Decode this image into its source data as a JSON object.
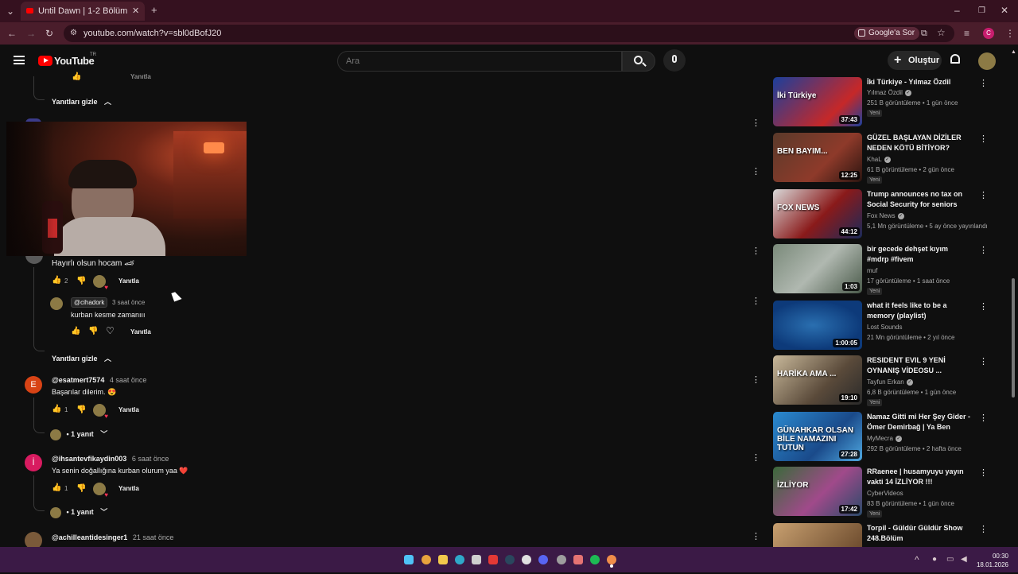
{
  "browser": {
    "tab_title": "Until Dawn | 1-2 Bölüm - YouTube",
    "url": "youtube.com/watch?v=sbl0dBofJ20",
    "google_button": "Google'a Sor"
  },
  "header": {
    "logo": "YouTube",
    "region": "TR",
    "search_placeholder": "Ara",
    "create_label": "Oluştur"
  },
  "comments": {
    "hide_replies": "Yanıtları gizle",
    "reply_label": "Yanıtla",
    "c1": {
      "text": "Hayırlı olsun hocam 🏎",
      "likes": "2"
    },
    "c1_reply": {
      "mention": "@cihadork",
      "time": "3 saat önce",
      "text": "kurban kesme zamanııı"
    },
    "c2": {
      "author": "@esatmert7574",
      "time": "4 saat önce",
      "text": "Başarılar dilerim. 😍",
      "likes": "1",
      "avatar_letter": "E",
      "replies": "• 1 yanıt"
    },
    "c3": {
      "author": "@ihsantevfikaydin003",
      "time": "6 saat önce",
      "text": "Ya senin doğallığına kurban olurum yaa ❤️",
      "likes": "1",
      "avatar_letter": "İ",
      "replies": "• 1 yanıt"
    },
    "c4": {
      "author": "@achilleantidesinger1",
      "time": "21 saat önce"
    }
  },
  "sidebar": [
    {
      "title": "İki Türkiye - Yılmaz Özdil",
      "channel": "Yılmaz Özdil",
      "verified": true,
      "meta": "251 B görüntüleme • 1 gün önce",
      "badge": "Yeni",
      "duration": "37:43",
      "thumb_text": "İki Türkiye"
    },
    {
      "title": "GÜZEL BAŞLAYAN DİZİLER NEDEN KÖTÜ BİTİYOR?",
      "channel": "KhaL",
      "verified": true,
      "meta": "61 B görüntüleme • 2 gün önce",
      "badge": "Yeni",
      "duration": "12:25",
      "thumb_text": "BEN BAYIM..."
    },
    {
      "title": "Trump announces no tax on Social Security for seniors",
      "channel": "Fox News",
      "verified": true,
      "meta": "5,1 Mn görüntüleme • 5 ay önce yayınlandı",
      "badge": "",
      "duration": "44:12",
      "thumb_text": "FOX NEWS"
    },
    {
      "title": "bir gecede dehşet kıyım #mdrp #fivem",
      "channel": "muf",
      "verified": false,
      "meta": "17 görüntüleme • 1 saat önce",
      "badge": "Yeni",
      "duration": "1:03",
      "thumb_text": ""
    },
    {
      "title": "what it feels like to be a memory (playlist)",
      "channel": "Lost Sounds",
      "verified": false,
      "meta": "21 Mn görüntüleme • 2 yıl önce",
      "badge": "",
      "duration": "1:00:05",
      "thumb_text": ""
    },
    {
      "title": "RESIDENT EVIL 9 YENİ OYNANIŞ VİDEOSU ...",
      "channel": "Tayfun Erkan",
      "verified": true,
      "meta": "6,8 B görüntüleme • 1 gün önce",
      "badge": "Yeni",
      "duration": "19:10",
      "thumb_text": "HARİKA AMA ..."
    },
    {
      "title": "Namaz Gitti mi Her Şey Gider - Ömer Demirbağ | Ya Ben Öleyi...",
      "channel": "MyMecra",
      "verified": true,
      "meta": "292 B görüntüleme • 2 hafta önce",
      "badge": "",
      "duration": "27:28",
      "thumb_text": "GÜNAHKAR OLSAN BİLE NAMAZINI TUTUN"
    },
    {
      "title": "RRaenee | husamyuyu yayın vakti 14 İZLİYOR !!!",
      "channel": "CyberVideos",
      "verified": false,
      "meta": "83 B görüntüleme • 1 gün önce",
      "badge": "Yeni",
      "duration": "17:42",
      "thumb_text": "İZLİYOR"
    },
    {
      "title": "Torpil - Güldür Güldür Show 248.Bölüm",
      "channel": "",
      "verified": false,
      "meta": "",
      "badge": "",
      "duration": "",
      "thumb_text": ""
    }
  ],
  "taskbar": {
    "time": "00:30",
    "date": "18.01.2026"
  },
  "colors": {
    "tab_bar": "#35111f",
    "address_bar": "#4a1d2b",
    "page_bg": "#0f0f0f",
    "taskbar": "#3b1a46",
    "youtube_red": "#ff0000"
  }
}
